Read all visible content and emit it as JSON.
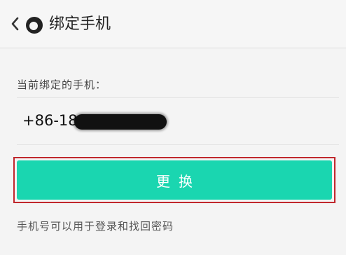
{
  "header": {
    "back_icon": "chevron-left-icon",
    "logo_icon": "app-logo-icon",
    "title": "绑定手机"
  },
  "main": {
    "current_label": "当前绑定的手机：",
    "phone_visible": "+86-183",
    "change_button": "更换",
    "hint": "手机号可以用于登录和找回密码"
  },
  "colors": {
    "accent": "#1ad6b0",
    "highlight_border": "#c0272d"
  }
}
